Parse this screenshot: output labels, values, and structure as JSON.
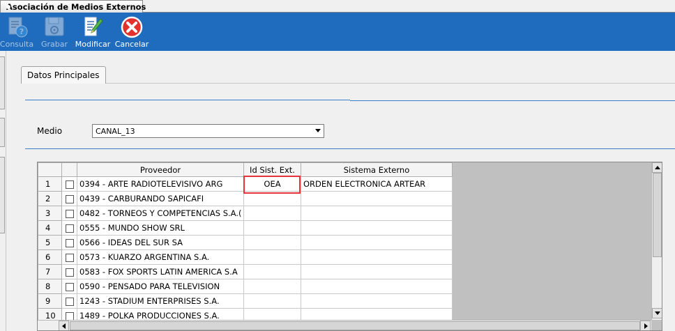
{
  "window": {
    "tab_title": "Asociación de Medios Externos"
  },
  "toolbar": {
    "consulta_label": "Consulta",
    "grabar_label": "Grabar",
    "modificar_label": "Modificar",
    "cancelar_label": "Cancelar"
  },
  "panel": {
    "tab_label": "Datos Principales"
  },
  "form": {
    "medio_label": "Medio",
    "medio_value": "CANAL_13"
  },
  "grid": {
    "headers": {
      "proveedor": "Proveedor",
      "id_sist_ext": "Id Sist. Ext.",
      "sistema_externo": "Sistema Externo"
    },
    "rows": [
      {
        "num": "1",
        "proveedor": "0394 - ARTE RADIOTELEVISIVO ARG",
        "id_sist_ext": "OEA",
        "sistema_externo": "ORDEN ELECTRONICA ARTEAR"
      },
      {
        "num": "2",
        "proveedor": "0439 - CARBURANDO SAPICAFI",
        "id_sist_ext": "",
        "sistema_externo": ""
      },
      {
        "num": "3",
        "proveedor": "0482 - TORNEOS Y COMPETENCIAS S.A.(",
        "id_sist_ext": "",
        "sistema_externo": ""
      },
      {
        "num": "4",
        "proveedor": "0555 - MUNDO SHOW SRL",
        "id_sist_ext": "",
        "sistema_externo": ""
      },
      {
        "num": "5",
        "proveedor": "0566 - IDEAS DEL SUR SA",
        "id_sist_ext": "",
        "sistema_externo": ""
      },
      {
        "num": "6",
        "proveedor": "0573 - KUARZO ARGENTINA S.A.",
        "id_sist_ext": "",
        "sistema_externo": ""
      },
      {
        "num": "7",
        "proveedor": "0583 - FOX SPORTS LATIN AMERICA S.A",
        "id_sist_ext": "",
        "sistema_externo": ""
      },
      {
        "num": "8",
        "proveedor": "0590 - PENSADO PARA TELEVISION",
        "id_sist_ext": "",
        "sistema_externo": ""
      },
      {
        "num": "9",
        "proveedor": "1243 - STADIUM ENTERPRISES S.A.",
        "id_sist_ext": "",
        "sistema_externo": ""
      },
      {
        "num": "10",
        "proveedor": "1489 - POLKA PRODUCCIONES S.A.",
        "id_sist_ext": "",
        "sistema_externo": ""
      }
    ]
  },
  "colors": {
    "toolbar_bg": "#1f6cbf",
    "highlight": "#e8323c",
    "cancel_icon": "#e3312e"
  }
}
